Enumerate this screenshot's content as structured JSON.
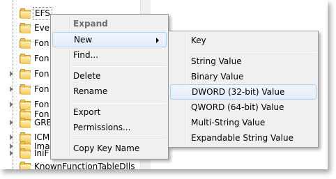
{
  "tree": {
    "items": [
      {
        "label": "EFS",
        "selected": true,
        "expandable": false
      },
      {
        "label": "Eve",
        "expandable": false
      },
      {
        "label": "Fon",
        "expandable": false
      },
      {
        "label": "Fon",
        "expandable": false
      },
      {
        "label": "Fon",
        "expandable": true
      },
      {
        "label": "Fon",
        "expandable": true
      },
      {
        "label": "Fon",
        "expandable": true
      },
      {
        "label": "Fon",
        "expandable": false
      },
      {
        "label": "GRE",
        "expandable": true
      },
      {
        "label": "ICM",
        "expandable": true
      },
      {
        "label": "Ima",
        "expandable": true
      },
      {
        "label": "IniF",
        "expandable": true
      },
      {
        "label": "KnownFunctionTableDlls",
        "expandable": false
      }
    ]
  },
  "context_menu": {
    "expand": "Expand",
    "new": "New",
    "find": "Find...",
    "delete": "Delete",
    "rename": "Rename",
    "export": "Export",
    "permissions": "Permissions...",
    "copy_key_name": "Copy Key Name"
  },
  "new_submenu": {
    "key": "Key",
    "string_value": "String Value",
    "binary_value": "Binary Value",
    "dword_value": "DWORD (32-bit) Value",
    "qword_value": "QWORD (64-bit) Value",
    "multi_string_value": "Multi-String Value",
    "expandable_string_value": "Expandable String Value"
  }
}
